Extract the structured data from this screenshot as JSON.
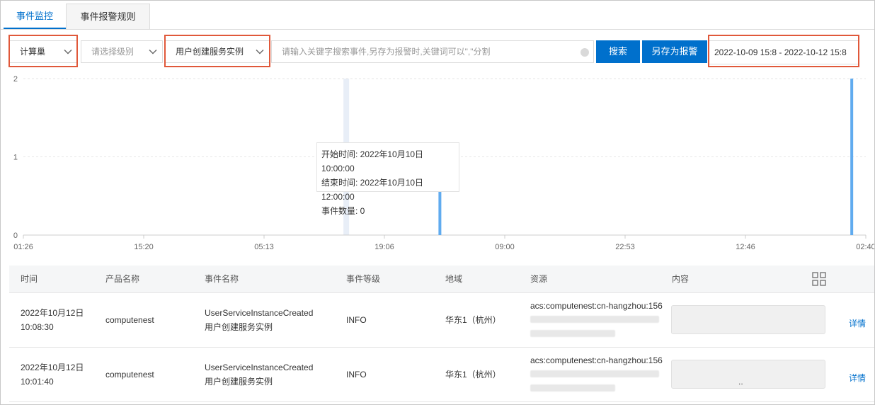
{
  "tabs": [
    "事件监控",
    "事件报警规则"
  ],
  "toolbar": {
    "product_select": "计算巢",
    "level_select_placeholder": "请选择级别",
    "event_select": "用户创建服务实例",
    "search_placeholder": "请输入关键字搜索事件,另存为报警时,关键词可以\",\"分割",
    "search_button": "搜索",
    "save_alarm_button": "另存为报警",
    "date_range": "2022-10-09 15:8 - 2022-10-12 15:8"
  },
  "colors": {
    "accent": "#0070cc",
    "highlight": "#e0583a",
    "bar": "#60abef"
  },
  "chart_data": {
    "type": "bar",
    "x_ticks": [
      "01:26",
      "15:20",
      "05:13",
      "19:06",
      "09:00",
      "22:53",
      "12:46",
      "02:40"
    ],
    "y_ticks": [
      "0",
      "1",
      "2"
    ],
    "ylim": [
      0,
      2
    ],
    "xlim": [
      0,
      9
    ],
    "bars": [
      {
        "x": 4.45,
        "value": 1
      },
      {
        "x": 8.85,
        "value": 2
      }
    ],
    "hover_band_x": 3.45,
    "tooltip": {
      "start": "开始时间: 2022年10月10日 10:00:00",
      "end": "结束时间: 2022年10月10日 12:00:00",
      "count": "事件数量: 0"
    }
  },
  "table": {
    "headers": [
      "时间",
      "产品名称",
      "事件名称",
      "事件等级",
      "地域",
      "资源",
      "内容"
    ],
    "rows": [
      {
        "date": "2022年10月12日",
        "time": "10:08:30",
        "product": "computenest",
        "event_name": "UserServiceInstanceCreated",
        "event_name_cn": "用户创建服务实例",
        "level": "INFO",
        "region": "华东1（杭州）",
        "resource": "acs:computenest:cn-hangzhou:156",
        "content_suffix": "",
        "detail": "详情"
      },
      {
        "date": "2022年10月12日",
        "time": "10:01:40",
        "product": "computenest",
        "event_name": "UserServiceInstanceCreated",
        "event_name_cn": "用户创建服务实例",
        "level": "INFO",
        "region": "华东1（杭州）",
        "resource": "acs:computenest:cn-hangzhou:156",
        "content_suffix": "..",
        "detail": "详情"
      }
    ]
  }
}
